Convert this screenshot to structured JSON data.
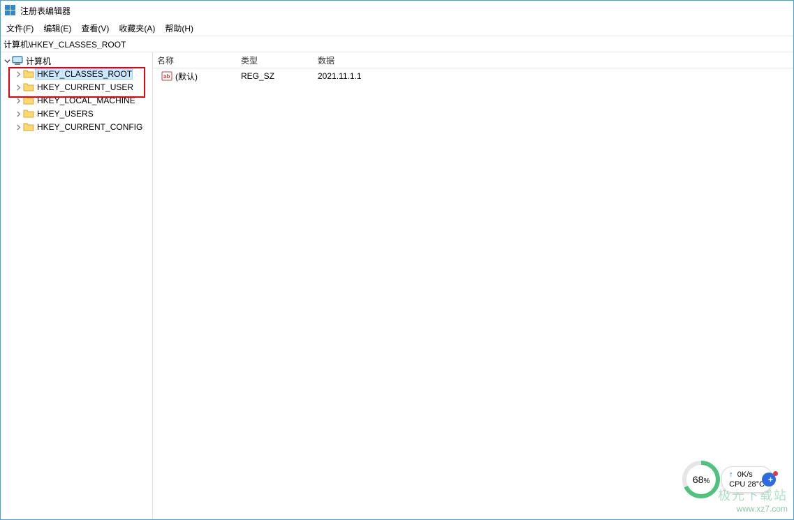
{
  "window": {
    "title": "注册表编辑器"
  },
  "menubar": {
    "file": "文件(F)",
    "edit": "编辑(E)",
    "view": "查看(V)",
    "favorites": "收藏夹(A)",
    "help": "帮助(H)"
  },
  "addressbar": {
    "value": "计算机\\HKEY_CLASSES_ROOT"
  },
  "tree": {
    "root": "计算机",
    "items": [
      {
        "label": "HKEY_CLASSES_ROOT",
        "selected": true
      },
      {
        "label": "HKEY_CURRENT_USER"
      },
      {
        "label": "HKEY_LOCAL_MACHINE"
      },
      {
        "label": "HKEY_USERS"
      },
      {
        "label": "HKEY_CURRENT_CONFIG"
      }
    ]
  },
  "list": {
    "headers": {
      "name": "名称",
      "type": "类型",
      "data": "数据"
    },
    "rows": [
      {
        "name": "(默认)",
        "type": "REG_SZ",
        "data": "2021.11.1.1"
      }
    ]
  },
  "floater": {
    "percent": "68",
    "pctUnit": "%",
    "up": "0K/s",
    "cpu": "CPU 28°C"
  },
  "watermark": {
    "name": "极光下载站",
    "url": "www.xz7.com"
  }
}
